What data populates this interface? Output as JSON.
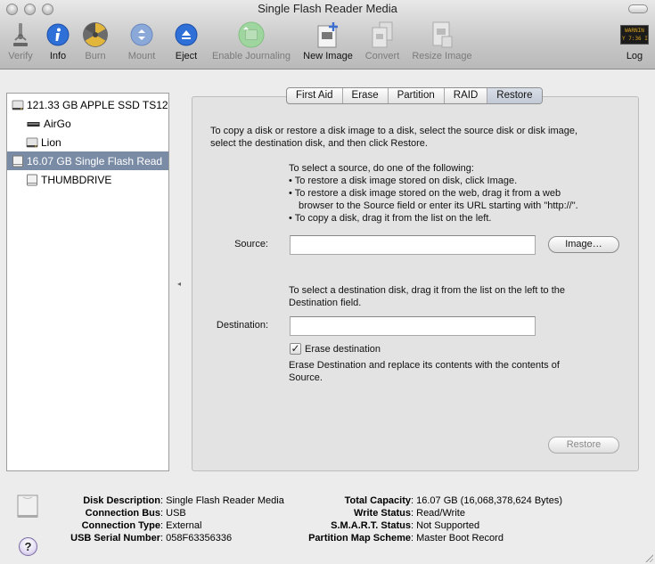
{
  "window": {
    "title": "Single Flash Reader Media"
  },
  "toolbar": {
    "items": [
      {
        "id": "verify",
        "label": "Verify",
        "icon": "microscope-icon",
        "enabled": false
      },
      {
        "id": "info",
        "label": "Info",
        "icon": "info-icon",
        "enabled": true
      },
      {
        "id": "burn",
        "label": "Burn",
        "icon": "burn-icon",
        "enabled": false
      },
      {
        "id": "mount",
        "label": "Mount",
        "icon": "mount-icon",
        "enabled": false
      },
      {
        "id": "eject",
        "label": "Eject",
        "icon": "eject-icon",
        "enabled": true
      },
      {
        "id": "enable-journaling",
        "label": "Enable Journaling",
        "icon": "journaling-icon",
        "enabled": false
      },
      {
        "id": "new-image",
        "label": "New Image",
        "icon": "new-image-icon",
        "enabled": true
      },
      {
        "id": "convert",
        "label": "Convert",
        "icon": "convert-icon",
        "enabled": false
      },
      {
        "id": "resize-image",
        "label": "Resize Image",
        "icon": "resize-image-icon",
        "enabled": false
      },
      {
        "id": "log",
        "label": "Log",
        "icon": "log-icon",
        "enabled": true
      }
    ],
    "log_icon_text": [
      "WARNIN",
      "Y 7:36 I"
    ]
  },
  "sidebar": {
    "items": [
      {
        "label": "121.33 GB APPLE SSD TS12",
        "level": 0,
        "icon": "internal-disk-icon",
        "selected": false
      },
      {
        "label": "AirGo",
        "level": 1,
        "icon": "volume-icon",
        "selected": false
      },
      {
        "label": "Lion",
        "level": 1,
        "icon": "internal-disk-icon",
        "selected": false
      },
      {
        "label": "16.07 GB Single Flash Read",
        "level": 0,
        "icon": "external-disk-icon",
        "selected": true
      },
      {
        "label": "THUMBDRIVE",
        "level": 1,
        "icon": "external-disk-icon",
        "selected": false
      }
    ]
  },
  "tabs": [
    {
      "label": "First Aid",
      "active": false
    },
    {
      "label": "Erase",
      "active": false
    },
    {
      "label": "Partition",
      "active": false
    },
    {
      "label": "RAID",
      "active": false
    },
    {
      "label": "Restore",
      "active": true
    }
  ],
  "restore": {
    "intro_line1": "To copy a disk or restore a disk image to a disk, select the source disk or disk image,",
    "intro_line2": "select the destination disk, and then click Restore.",
    "source_help_title": "To select a source, do one of the following:",
    "source_help_bullets": [
      "To restore a disk image stored on disk, click Image.",
      "To restore a disk image stored on the web, drag it from a web",
      "browser to the Source field or enter its URL starting with \"http://\".",
      "To copy a disk, drag it from the list on the left."
    ],
    "source_label": "Source:",
    "source_value": "",
    "image_button": "Image…",
    "dest_help_line1": "To select a destination disk, drag it from the list on the left to the",
    "dest_help_line2": "Destination field.",
    "destination_label": "Destination:",
    "destination_value": "",
    "erase_checkbox_label": "Erase destination",
    "erase_checked": true,
    "erase_desc_line1": "Erase Destination and replace its contents with the contents of",
    "erase_desc_line2": "Source.",
    "restore_button": "Restore"
  },
  "disk_info": {
    "left": [
      {
        "key": "Disk Description",
        "value": "Single Flash Reader Media"
      },
      {
        "key": "Connection Bus",
        "value": "USB"
      },
      {
        "key": "Connection Type",
        "value": "External"
      },
      {
        "key": "USB Serial Number",
        "value": "058F63356336"
      }
    ],
    "right": [
      {
        "key": "Total Capacity",
        "value": "16.07 GB (16,068,378,624 Bytes)"
      },
      {
        "key": "Write Status",
        "value": "Read/Write"
      },
      {
        "key": "S.M.A.R.T. Status",
        "value": "Not Supported"
      },
      {
        "key": "Partition Map Scheme",
        "value": "Master Boot Record"
      }
    ],
    "separator": ":",
    "help_label": "?"
  }
}
